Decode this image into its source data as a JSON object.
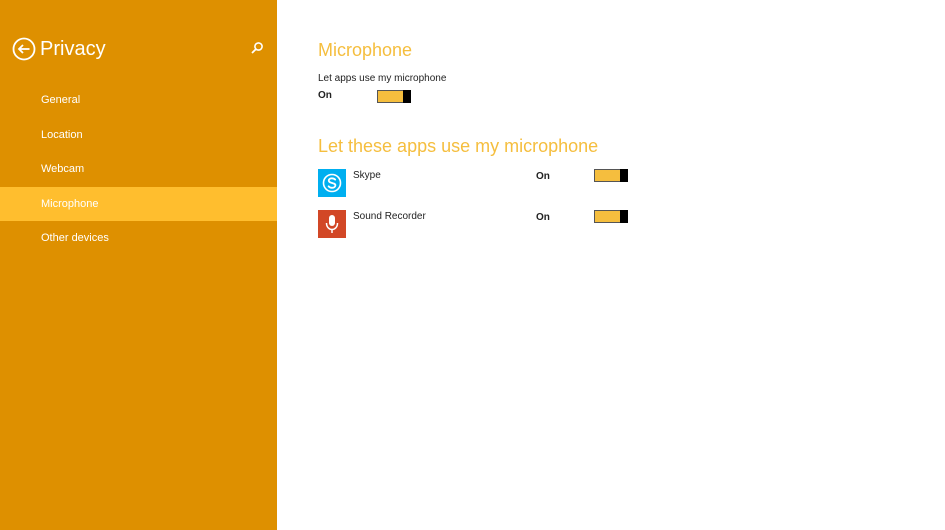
{
  "colors": {
    "sidebar_bg": "#DE9000",
    "active_item_bg": "#FFBE2E",
    "accent": "#F5BE3E",
    "skype_blue": "#00AFF0",
    "recorder_red": "#D24726"
  },
  "sidebar": {
    "title": "Privacy",
    "back_icon": "back-arrow-circle-icon",
    "search_icon": "search-icon",
    "items": [
      {
        "label": "General",
        "active": false
      },
      {
        "label": "Location",
        "active": false
      },
      {
        "label": "Webcam",
        "active": false
      },
      {
        "label": "Microphone",
        "active": true
      },
      {
        "label": "Other devices",
        "active": false
      }
    ]
  },
  "main": {
    "title": "Microphone",
    "global_setting": {
      "label": "Let apps use my microphone",
      "state": "On",
      "on": true
    },
    "apps_section_title": "Let these apps use my microphone",
    "apps": [
      {
        "name": "Skype",
        "state": "On",
        "on": true,
        "icon": "skype-icon"
      },
      {
        "name": "Sound Recorder",
        "state": "On",
        "on": true,
        "icon": "microphone-icon"
      }
    ]
  }
}
